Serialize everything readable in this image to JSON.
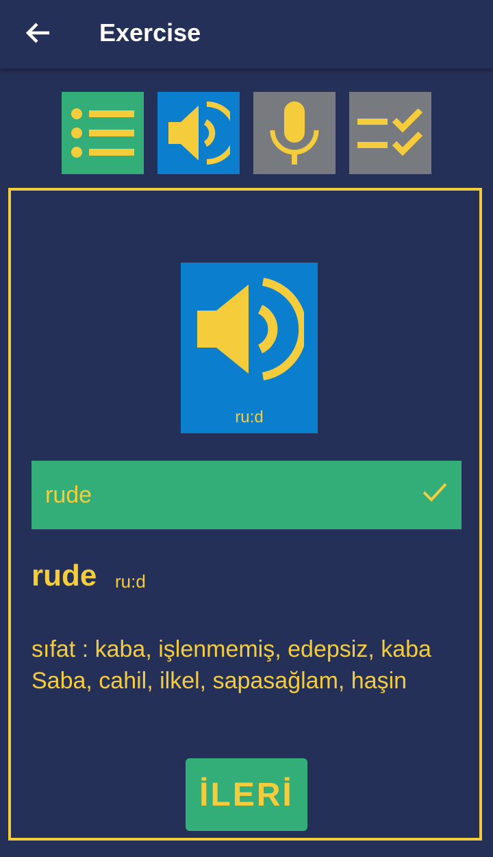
{
  "appbar": {
    "title": "Exercise",
    "back_icon": "arrow-left-icon"
  },
  "mode_tabs": [
    {
      "icon": "list-icon",
      "active": true,
      "color": "#33ae78"
    },
    {
      "icon": "speaker-icon",
      "active": true,
      "color": "#0b7fcd"
    },
    {
      "icon": "microphone-icon",
      "active": false,
      "color": "#777a7f"
    },
    {
      "icon": "checklist-icon",
      "active": false,
      "color": "#777a7f"
    }
  ],
  "audio_card": {
    "icon": "speaker-icon",
    "phonetic": "ru:d"
  },
  "answer": {
    "text": "rude",
    "status_icon": "check-icon"
  },
  "word": {
    "text": "rude",
    "phonetic": "ru:d"
  },
  "meaning": "sıfat : kaba, işlenmemiş, edepsiz, kaba Saba, cahil, ilkel, sapasağlam, haşin",
  "next_button": {
    "label": "İLERİ"
  },
  "colors": {
    "background": "#253058",
    "accent": "#f5cd3c",
    "green": "#33ae78",
    "blue": "#0b7fcd",
    "inactive": "#777a7f"
  }
}
